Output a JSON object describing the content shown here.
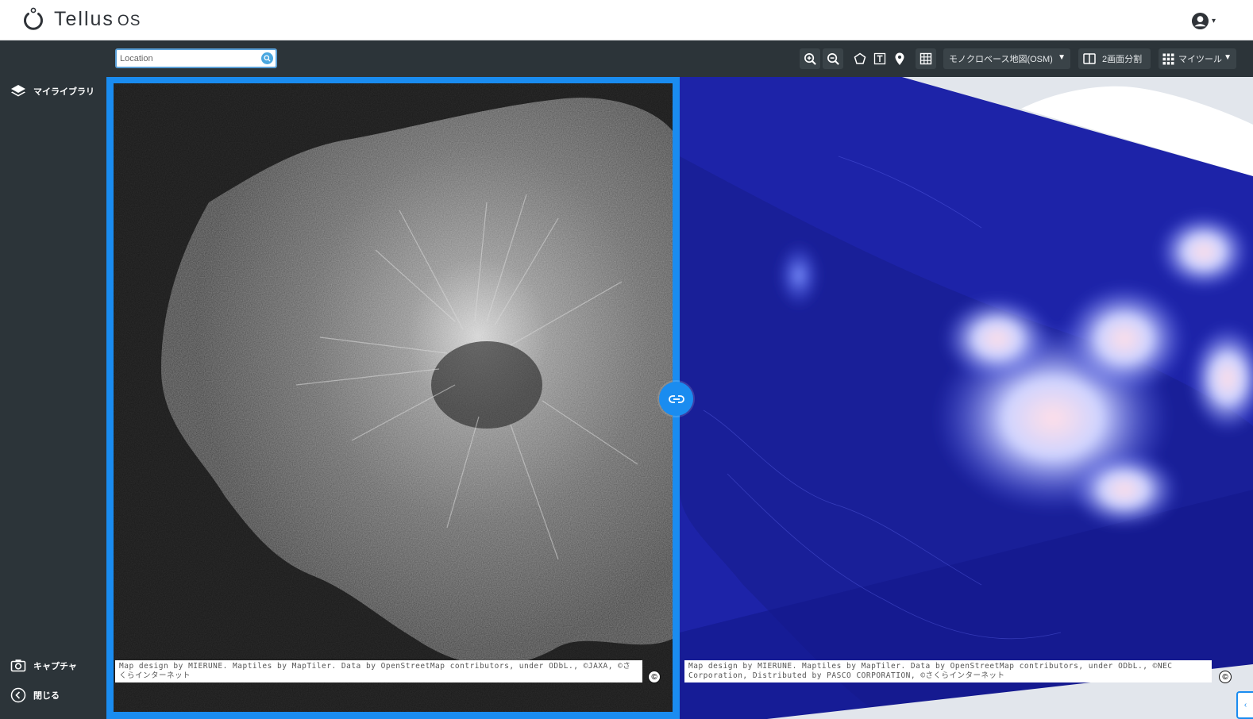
{
  "app": {
    "logo_text": "Tellus",
    "logo_suffix": "OS"
  },
  "header": {
    "account_icon": "user-circle-icon"
  },
  "sidebar": {
    "library_label": "マイライブラリ",
    "capture_label": "キャプチャ",
    "close_label": "閉じる"
  },
  "toolbar": {
    "search_placeholder": "Location",
    "basemap_select": "モノクロベース地図(OSM)",
    "split_label": "2画面分割",
    "mytools_label": "マイツール"
  },
  "maps": {
    "left_attribution": "Map design by MIERUNE. Maptiles by MapTiler. Data by OpenStreetMap contributors, under ODbL., ©JAXA, ©さくらインターネット",
    "right_attribution": "Map design by MIERUNE. Maptiles by MapTiler. Data by OpenStreetMap contributors, under ODbL., ©NEC Corporation, Distributed by PASCO CORPORATION, ©さくらインターネット",
    "copyright_glyph": "©"
  },
  "colors": {
    "accent": "#1a8cf0",
    "sidebar_bg": "#2c3439",
    "header_bg": "#ffffff"
  }
}
